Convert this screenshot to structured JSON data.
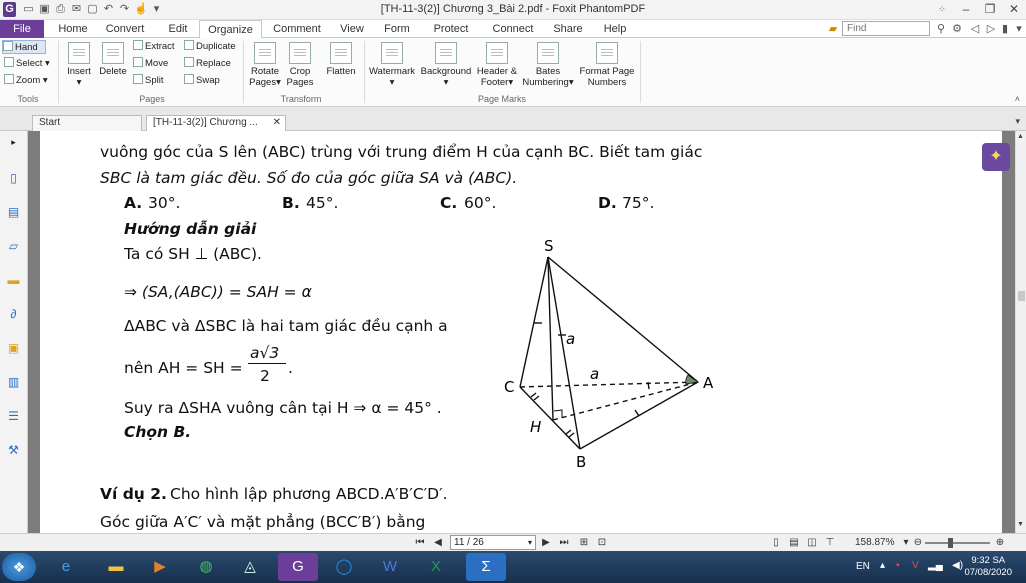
{
  "window": {
    "title": "[TH-11-3(2)] Chương 3_Bài 2.pdf - Foxit PhantomPDF",
    "app_icon": "G"
  },
  "ribbon_tabs": [
    "File",
    "Home",
    "Convert",
    "Edit",
    "Organize",
    "Comment",
    "View",
    "Form",
    "Protect",
    "Connect",
    "Share",
    "Help"
  ],
  "active_ribbon_tab": "Organize",
  "find": {
    "placeholder": "Find"
  },
  "tools": {
    "hand": "Hand",
    "select": "Select",
    "zoom": "Zoom",
    "group": "Tools"
  },
  "pages": {
    "insert": "Insert",
    "delete": "Delete",
    "extract": "Extract",
    "duplicate": "Duplicate",
    "move": "Move",
    "replace": "Replace",
    "split": "Split",
    "swap": "Swap",
    "group": "Pages"
  },
  "transform": {
    "rotate": "Rotate Pages",
    "crop": "Crop Pages",
    "flatten": "Flatten",
    "group": "Transform"
  },
  "page_marks": {
    "watermark": "Watermark",
    "background": "Background",
    "header_footer": "Header & Footer",
    "bates": "Bates Numbering",
    "format": "Format Page Numbers",
    "group": "Page Marks"
  },
  "doc_tabs": {
    "start": "Start",
    "doc": "[TH-11-3(2)] Chương ..."
  },
  "content": {
    "l1": "vuông góc của S lên (ABC) trùng với trung điểm H của cạnh BC. Biết tam giác",
    "l2": "SBC là tam giác đều. Số đo của góc giữa SA và (ABC).",
    "optA_l": "A.",
    "optA": "30°.",
    "optB_l": "B.",
    "optB": "45°.",
    "optC_l": "C.",
    "optC": "60°.",
    "optD_l": "D.",
    "optD": "75°.",
    "guide": "Hướng dẫn giải",
    "s1": "Ta có SH ⊥ (ABC).",
    "s2": "⇒ (SA,(ABC)) = SAH = α",
    "s3": "ΔABC  và  ΔSBC  là hai tam giác đều cạnh a",
    "s4a": "nên  AH = SH =",
    "s4num": "a√3",
    "s4den": "2",
    "s4end": ".",
    "s5": "Suy ra  ΔSHA  vuông cân tại H ⇒ α = 45° .",
    "s6": "Chọn B.",
    "ex2_label": "Ví dụ 2.",
    "ex2": "Cho hình lập phương ABCD.A′B′C′D′.",
    "ex2b": "Góc giữa A′C′ và mặt phẳng (BCC′B′) bằng"
  },
  "figure": {
    "S": "S",
    "A": "A",
    "B": "B",
    "C": "C",
    "H": "H",
    "a1": "a",
    "a2": "a"
  },
  "status": {
    "page": "11 / 26",
    "zoom": "158.87%"
  },
  "tray": {
    "lang": "EN",
    "time": "9:32 SA",
    "date": "07/08/2020"
  }
}
